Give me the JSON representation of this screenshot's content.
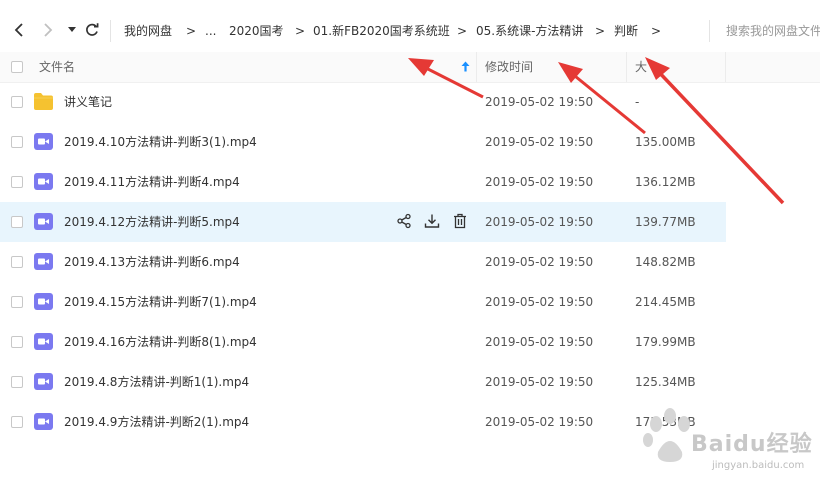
{
  "nav": {
    "breadcrumbs": [
      "我的网盘",
      "...",
      "2020国考",
      "01.新FB2020国考系统班",
      "05.系统课-方法精讲",
      "判断"
    ],
    "search_placeholder": "搜索我的网盘文件"
  },
  "header": {
    "name_col": "文件名",
    "date_col": "修改时间",
    "size_col": "大"
  },
  "files": [
    {
      "name": "讲义笔记",
      "type": "folder",
      "date": "2019-05-02 19:50",
      "size": "-"
    },
    {
      "name": "2019.4.10方法精讲-判断3(1).mp4",
      "type": "video",
      "date": "2019-05-02 19:50",
      "size": "135.00MB"
    },
    {
      "name": "2019.4.11方法精讲-判断4.mp4",
      "type": "video",
      "date": "2019-05-02 19:50",
      "size": "136.12MB"
    },
    {
      "name": "2019.4.12方法精讲-判断5.mp4",
      "type": "video",
      "date": "2019-05-02 19:50",
      "size": "139.77MB"
    },
    {
      "name": "2019.4.13方法精讲-判断6.mp4",
      "type": "video",
      "date": "2019-05-02 19:50",
      "size": "148.82MB"
    },
    {
      "name": "2019.4.15方法精讲-判断7(1).mp4",
      "type": "video",
      "date": "2019-05-02 19:50",
      "size": "214.45MB"
    },
    {
      "name": "2019.4.16方法精讲-判断8(1).mp4",
      "type": "video",
      "date": "2019-05-02 19:50",
      "size": "179.99MB"
    },
    {
      "name": "2019.4.8方法精讲-判断1(1).mp4",
      "type": "video",
      "date": "2019-05-02 19:50",
      "size": "125.34MB"
    },
    {
      "name": "2019.4.9方法精讲-判断2(1).mp4",
      "type": "video",
      "date": "2019-05-02 19:50",
      "size": "173.53MB"
    }
  ],
  "watermark": {
    "brand": "Baidu经验",
    "url": "jingyan.baidu.com"
  },
  "colors": {
    "hover_row": "#e8f5fd",
    "folder": "#f5c230",
    "video": "#7b79f0",
    "arrow": "#e53935",
    "sort_arrow": "#1a90ff"
  }
}
